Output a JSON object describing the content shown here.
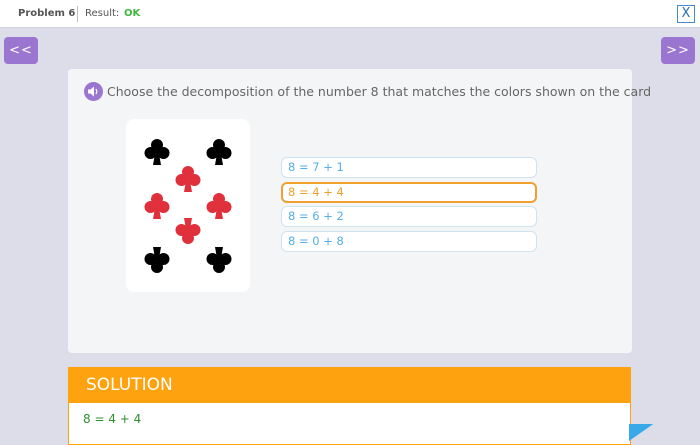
{
  "topbar": {
    "problem_label": "Problem 6",
    "result_label": "Result:",
    "result_value": "OK",
    "close_label": "X"
  },
  "nav": {
    "prev_label": "<<",
    "next_label": ">>"
  },
  "question": {
    "text": "Choose the decomposition of the number 8 that matches the colors shown on the card"
  },
  "card": {
    "suit": "clubs",
    "count": 8,
    "black_count": 4,
    "red_count": 4,
    "black_color": "#000000",
    "red_color": "#e0303c"
  },
  "options": [
    {
      "label": "8 = 7 + 1",
      "selected": false
    },
    {
      "label": "8 = 4 + 4",
      "selected": true
    },
    {
      "label": "8 = 6 + 2",
      "selected": false
    },
    {
      "label": "8 = 0 + 8",
      "selected": false
    }
  ],
  "solution": {
    "title": "SOLUTION",
    "answer": "8 = 4 + 4"
  },
  "colors": {
    "accent_purple": "#9b76d0",
    "solution_orange": "#ffa20f",
    "option_blue": "#56aee8",
    "selected_orange": "#f0a030",
    "ok_green": "#3db83d"
  }
}
